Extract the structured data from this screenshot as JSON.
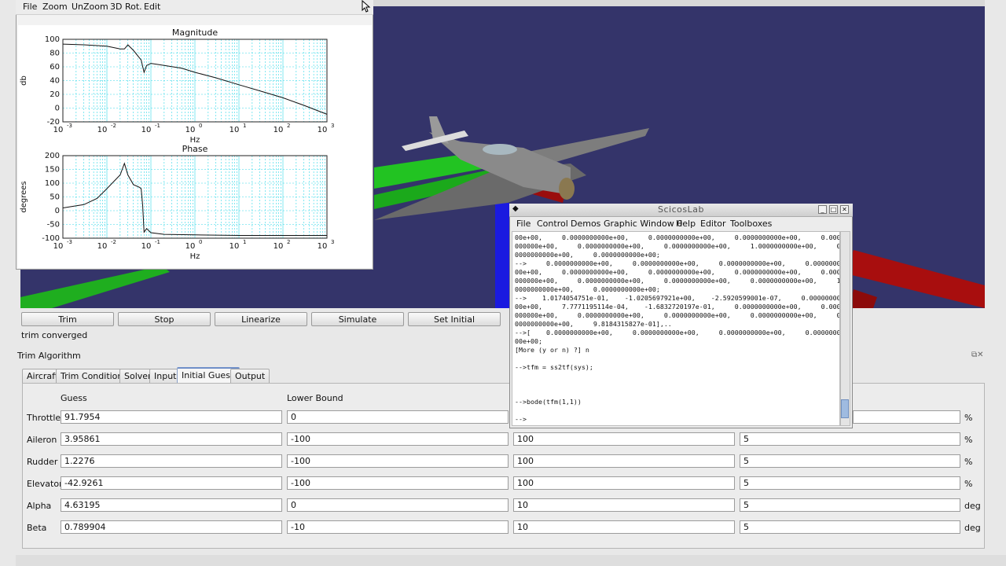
{
  "colors": {
    "viewport_bg": "#34346a",
    "green_tube": "#1fbf1f",
    "red_tube": "#a80e0e",
    "blue_tube": "#1a1ae0",
    "grid_cyan": "#30d8e8"
  },
  "plot_window": {
    "menu": [
      "File",
      "Zoom",
      "UnZoom",
      "3D Rot.",
      "Edit"
    ],
    "magnitude_title": "Magnitude",
    "magnitude_ylabel": "db",
    "magnitude_xlabel": "Hz",
    "magnitude_yticks": [
      "100",
      "80",
      "60",
      "40",
      "20",
      "0",
      "-20"
    ],
    "phase_title": "Phase",
    "phase_ylabel": "degrees",
    "phase_xlabel": "Hz",
    "phase_yticks": [
      "200",
      "150",
      "100",
      "50",
      "0",
      "-50",
      "-100"
    ],
    "xtick_base": "10",
    "xtick_exponents": [
      "-3",
      "-2",
      "-1",
      "0",
      "1",
      "2",
      "3"
    ]
  },
  "chart_data": [
    {
      "type": "line",
      "title": "Magnitude",
      "xlabel": "Hz",
      "ylabel": "db",
      "x_scale": "log",
      "xlim": [
        0.001,
        1000
      ],
      "ylim": [
        -20,
        100
      ],
      "grid": true,
      "x": [
        0.001,
        0.003,
        0.01,
        0.02,
        0.025,
        0.03,
        0.04,
        0.06,
        0.07,
        0.08,
        0.1,
        0.2,
        0.5,
        1,
        3,
        10,
        30,
        100,
        300,
        1000
      ],
      "series": [
        {
          "values": [
            93,
            92,
            90,
            86,
            86,
            92,
            84,
            70,
            52,
            62,
            65,
            62,
            58,
            52,
            44,
            34,
            25,
            15,
            4,
            -9
          ]
        }
      ]
    },
    {
      "type": "line",
      "title": "Phase",
      "xlabel": "Hz",
      "ylabel": "degrees",
      "x_scale": "log",
      "xlim": [
        0.001,
        1000
      ],
      "ylim": [
        -100,
        200
      ],
      "grid": true,
      "x": [
        0.001,
        0.003,
        0.006,
        0.01,
        0.02,
        0.025,
        0.03,
        0.04,
        0.055,
        0.06,
        0.065,
        0.07,
        0.08,
        0.1,
        0.2,
        1,
        10,
        1000
      ],
      "series": [
        {
          "values": [
            10,
            22,
            45,
            80,
            130,
            172,
            130,
            95,
            85,
            80,
            20,
            -78,
            -65,
            -80,
            -86,
            -88,
            -90,
            -90
          ]
        }
      ]
    }
  ],
  "console": {
    "title": "ScicosLab",
    "menu": [
      "File",
      "Control",
      "Demos",
      "Graphic Window 0",
      "Help",
      "Editor",
      "Toolboxes"
    ],
    "text": "00e+00,     0.0000000000e+00,     0.0000000000e+00,     0.0000000000e+00,     0.0000\n000000e+00,     0.0000000000e+00,     0.0000000000e+00,     1.0000000000e+00,     0.\n0000000000e+00,     0.0000000000e+00;\n-->     0.0000000000e+00,     0.0000000000e+00,     0.0000000000e+00,     0.00000000\n00e+00,     0.0000000000e+00,     0.0000000000e+00,     0.0000000000e+00,     0.0000\n000000e+00,     0.0000000000e+00,     0.0000000000e+00,     0.0000000000e+00,     1.\n0000000000e+00,     0.0000000000e+00;\n-->    1.0174054751e-01,    -1.0205697921e+00,    -2.5920599001e-07,     0.00000000\n00e+00,     7.7771195114e-04,    -1.6832720197e-01,     0.0000000000e+00,     0.0000\n000000e+00,     0.0000000000e+00,     0.0000000000e+00,     0.0000000000e+00,     0.\n0000000000e+00,     9.8184315827e-01],..\n-->[    0.0000000000e+00,     0.0000000000e+00,     0.0000000000e+00,     0.00000000\n00e+00;\n[More (y or n) ?] n\n\n-->tfm = ss2tf(sys);\n\n\n\n-->bode(tfm(1,1))\n\n-->"
  },
  "buttons": [
    "Trim",
    "Stop",
    "Linearize",
    "Simulate",
    "Set Initial"
  ],
  "status": "trim converged",
  "panel_title": "Trim Algorithm",
  "tabs": [
    "Aircraft",
    "Trim Conditions",
    "Solver",
    "Input",
    "Initial Guess",
    "Output"
  ],
  "active_tab": "Initial Guess",
  "columns": {
    "guess": "Guess",
    "lower": "Lower Bound"
  },
  "rows": [
    {
      "label": "Throttle",
      "guess": "91.7954",
      "lower": "0",
      "upper": "",
      "step": "",
      "unit": "%"
    },
    {
      "label": "Aileron",
      "guess": "3.95861",
      "lower": "-100",
      "upper": "100",
      "step": "5",
      "unit": "%"
    },
    {
      "label": "Rudder",
      "guess": "1.2276",
      "lower": "-100",
      "upper": "100",
      "step": "5",
      "unit": "%"
    },
    {
      "label": "Elevator",
      "guess": "-42.9261",
      "lower": "-100",
      "upper": "100",
      "step": "5",
      "unit": "%"
    },
    {
      "label": "Alpha",
      "guess": "4.63195",
      "lower": "0",
      "upper": "10",
      "step": "5",
      "unit": "deg"
    },
    {
      "label": "Beta",
      "guess": "0.789904",
      "lower": "-10",
      "upper": "10",
      "step": "5",
      "unit": "deg"
    }
  ]
}
